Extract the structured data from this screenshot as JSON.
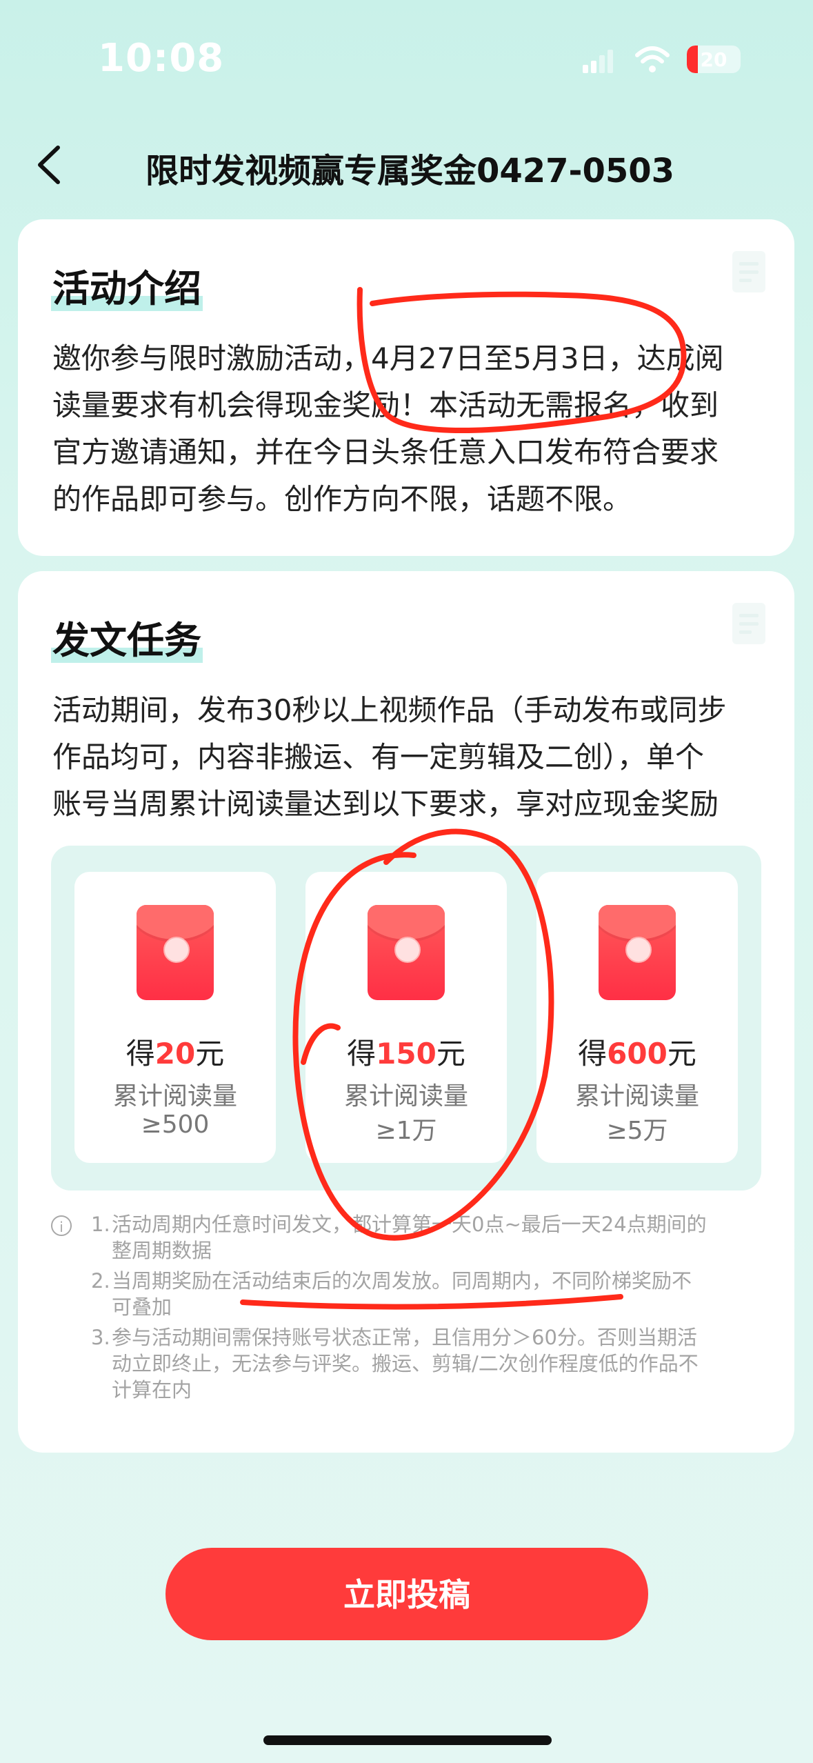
{
  "status_bar": {
    "time": "10:08",
    "battery_text": "20",
    "battery_level": 0.2
  },
  "nav": {
    "title": "限时发视频赢专属奖金0427-0503",
    "back_icon": "chevron-left-icon"
  },
  "intro": {
    "title": "活动介绍",
    "lines": [
      "邀你参与限时激励活动，4月27日至5月3日，达成阅",
      "读量要求有机会得现金奖励！本活动无需报名，收到",
      "官方邀请通知，并在今日头条任意入口发布符合要求",
      "的作品即可参与。创作方向不限，话题不限。"
    ]
  },
  "task": {
    "title": "发文任务",
    "lines": [
      "活动期间，发布30秒以上视频作品（手动发布或同步",
      "作品均可，内容非搬运、有一定剪辑及二创），单个",
      "账号当周累计阅读量达到以下要求，享对应现金奖励"
    ],
    "rewards": [
      {
        "prefix": "得",
        "amount": "20",
        "unit": "元",
        "label": "累计阅读量",
        "threshold": "≥500"
      },
      {
        "prefix": "得",
        "amount": "150",
        "unit": "元",
        "label": "累计阅读量",
        "threshold": "≥1万"
      },
      {
        "prefix": "得",
        "amount": "600",
        "unit": "元",
        "label": "累计阅读量",
        "threshold": "≥5万"
      }
    ],
    "notes": [
      {
        "num": "1.",
        "lines": [
          "活动周期内任意时间发文，都计算第一天0点~最后一天24点期间的",
          "整周期数据"
        ]
      },
      {
        "num": "2.",
        "lines": [
          "当周期奖励在活动结束后的次周发放。同周期内，不同阶梯奖励不",
          "可叠加"
        ]
      },
      {
        "num": "3.",
        "lines": [
          "参与活动期间需保持账号状态正常，且信用分＞60分。否则当期活",
          "动立即终止，无法参与评奖。搬运、剪辑/二次创作程度低的作品不",
          "计算在内"
        ]
      }
    ]
  },
  "submit_label": "立即投稿",
  "colors": {
    "accent": "#ff3b3b",
    "annotation": "#ff2a1a",
    "background": "#d9f5ef",
    "highlight": "#bff0ea"
  }
}
